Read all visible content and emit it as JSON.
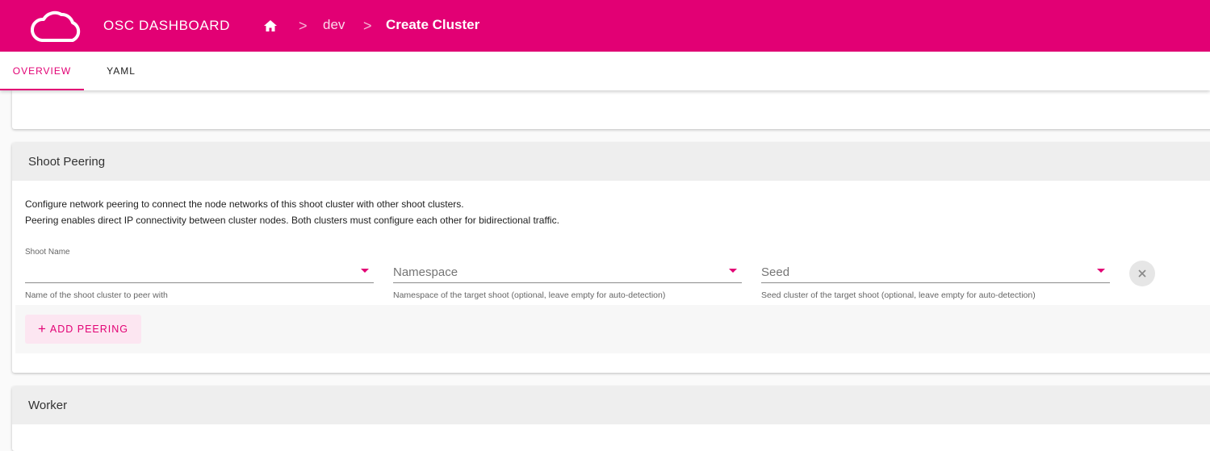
{
  "header": {
    "app_title": "OSC DASHBOARD",
    "logo_icon": "cloud-icon",
    "breadcrumbs": [
      {
        "icon": "home-icon"
      },
      {
        "label": "dev"
      },
      {
        "label": "Create Cluster"
      }
    ],
    "separator_glyph": ">",
    "color": "#e20074"
  },
  "tabs": [
    {
      "label": "OVERVIEW",
      "active": true
    },
    {
      "label": "YAML",
      "active": false
    }
  ],
  "shoot_peering": {
    "title": "Shoot Peering",
    "description_line1": "Configure network peering to connect the node networks of this shoot cluster with other shoot clusters.",
    "description_line2": "Peering enables direct IP connectivity between cluster nodes. Both clusters must configure each other for bidirectional traffic.",
    "fields": [
      {
        "label": "Shoot Name",
        "value": "",
        "hint": "Name of the shoot cluster to peer with"
      },
      {
        "placeholder": "Namespace",
        "value": "",
        "hint": "Namespace of the target shoot (optional, leave empty for auto-detection)"
      },
      {
        "placeholder": "Seed",
        "value": "",
        "hint": "Seed cluster of the target shoot (optional, leave empty for auto-detection)"
      }
    ],
    "remove_icon": "close-icon",
    "add_button": {
      "icon": "plus-icon",
      "label": "ADD PEERING"
    }
  },
  "worker": {
    "title": "Worker"
  }
}
